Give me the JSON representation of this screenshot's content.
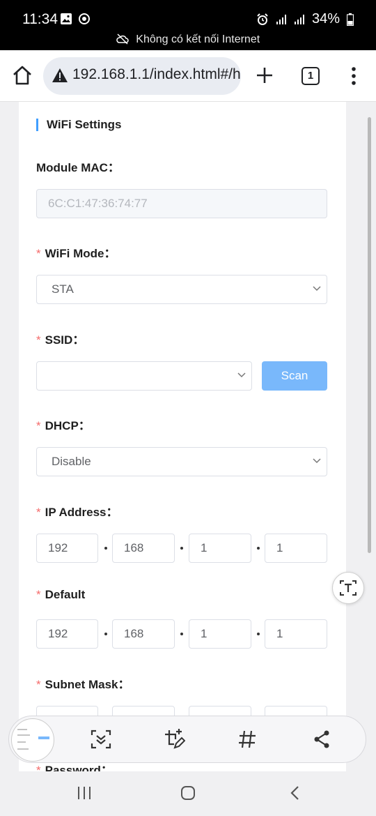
{
  "status_bar": {
    "time": "11:34",
    "battery": "34%",
    "no_connection": "Không có kết nối Internet"
  },
  "browser": {
    "url": "192.168.1.1/index.html#/h",
    "tab_count": "1"
  },
  "form": {
    "section_title": "WiFi Settings",
    "module_mac_label": "Module MAC：",
    "module_mac_value": "6C:C1:47:36:74:77",
    "wifi_mode_label": "WiFi Mode：",
    "wifi_mode_value": "STA",
    "ssid_label": "SSID：",
    "ssid_value": "",
    "scan_label": "Scan",
    "dhcp_label": "DHCP：",
    "dhcp_value": "Disable",
    "ip_label": "IP Address：",
    "ip": [
      "192",
      "168",
      "1",
      "1"
    ],
    "default_label": "Default",
    "gateway": [
      "192",
      "168",
      "1",
      "1"
    ],
    "subnet_label": "Subnet Mask：",
    "password_label": "Password：",
    "required_mark": "*"
  },
  "colors": {
    "accent": "#409eff",
    "required": "#f56c6c",
    "scan_button": "#79b8fb"
  },
  "icons": {
    "home": "home-icon",
    "warning": "warning-icon",
    "new_tab": "plus-icon",
    "menu": "more-vert-icon",
    "text_extract": "text-extract-icon",
    "scroll_capture": "scroll-capture-icon",
    "edit_crop": "crop-edit-icon",
    "hashtag": "hashtag-icon",
    "share": "share-icon"
  }
}
